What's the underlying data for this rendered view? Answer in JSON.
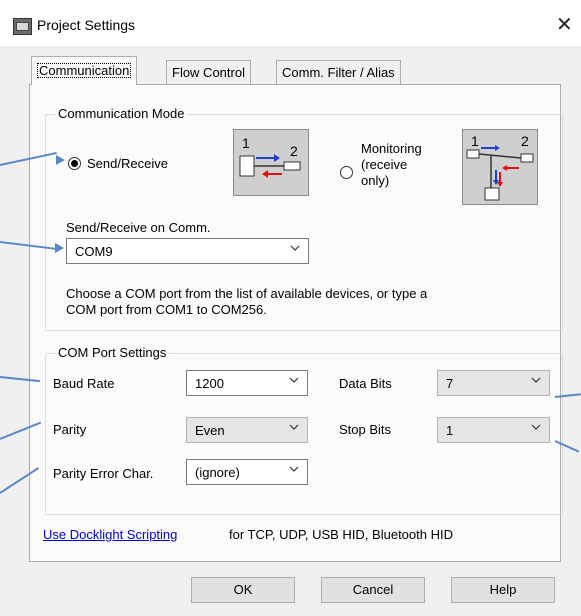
{
  "window": {
    "title": "Project Settings"
  },
  "tabs": [
    {
      "label": "Communication"
    },
    {
      "label": "Flow Control"
    },
    {
      "label": "Comm. Filter / Alias"
    }
  ],
  "comm_mode": {
    "title": "Communication Mode",
    "send_receive_label": "Send/Receive",
    "diagram_send_receive": {
      "left_num": "1",
      "right_num": "2"
    },
    "monitoring_lines": [
      "Monitoring",
      "(receive",
      "only)"
    ],
    "diagram_monitoring": {
      "left_num": "1",
      "right_num": "2"
    },
    "selected": "send_receive"
  },
  "port": {
    "label": "Send/Receive on Comm.",
    "value": "COM9",
    "hint_line1": "Choose a COM port from the list of available devices, or type a",
    "hint_line2": "COM port from COM1 to COM256."
  },
  "com_settings": {
    "title": "COM Port Settings",
    "baud_rate": {
      "label": "Baud Rate",
      "value": "1200"
    },
    "parity": {
      "label": "Parity",
      "value": "Even"
    },
    "parity_error_char": {
      "label": "Parity Error Char.",
      "value": "(ignore)"
    },
    "data_bits": {
      "label": "Data Bits",
      "value": "7"
    },
    "stop_bits": {
      "label": "Stop Bits",
      "value": "1"
    }
  },
  "scripting": {
    "link": "Use Docklight Scripting",
    "text": "for TCP, UDP, USB HID, Bluetooth HID"
  },
  "buttons": {
    "ok": "OK",
    "cancel": "Cancel",
    "help": "Help"
  },
  "colors": {
    "callout_arrow": "#5b87c4",
    "link": "#0000cc",
    "diagram_arrow_send": "#1f3fd0",
    "diagram_arrow_receive": "#e01010"
  }
}
